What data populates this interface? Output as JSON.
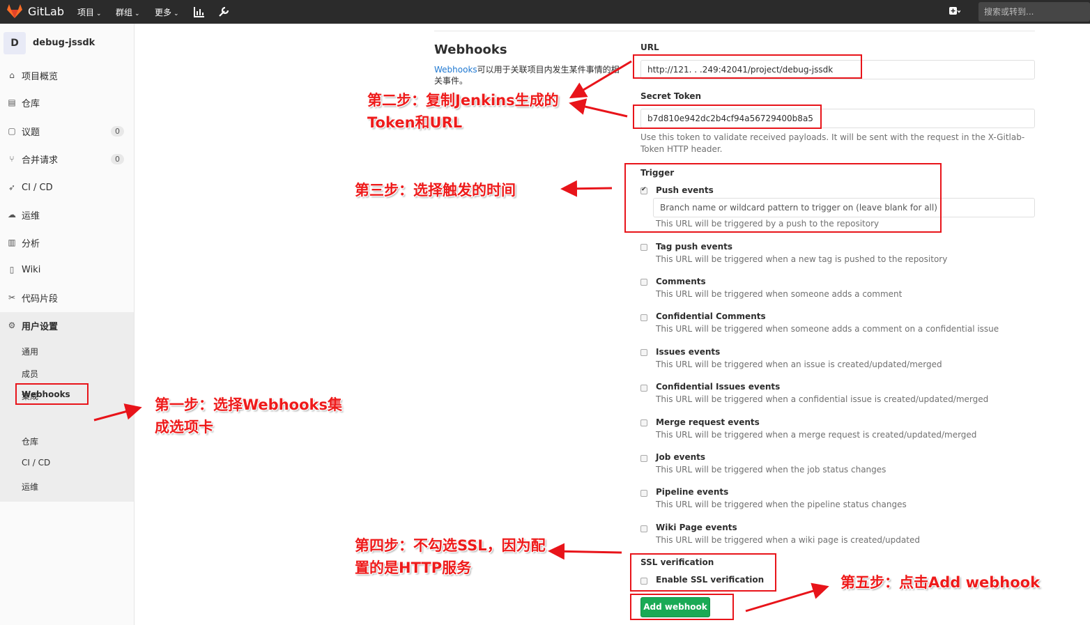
{
  "navbar": {
    "brand": "GitLab",
    "projects": "项目",
    "groups": "群组",
    "more": "更多",
    "search_placeholder": "搜索或转到..."
  },
  "sidebar": {
    "project_initial": "D",
    "project_name": "debug-jssdk",
    "items": [
      {
        "label": "项目概览",
        "icon": "home-icon"
      },
      {
        "label": "仓库",
        "icon": "doc-icon"
      },
      {
        "label": "议题",
        "icon": "issues-icon",
        "badge": "0"
      },
      {
        "label": "合并请求",
        "icon": "merge-icon",
        "badge": "0"
      },
      {
        "label": "CI / CD",
        "icon": "rocket-icon"
      },
      {
        "label": "运维",
        "icon": "cloud-icon"
      },
      {
        "label": "分析",
        "icon": "chart-icon"
      },
      {
        "label": "Wiki",
        "icon": "book-icon"
      },
      {
        "label": "代码片段",
        "icon": "scissors-icon"
      },
      {
        "label": "用户设置",
        "icon": "gear-icon"
      }
    ],
    "sub_items": [
      "通用",
      "成员",
      "集成",
      "Webhooks",
      "仓库",
      "CI / CD",
      "运维"
    ]
  },
  "main": {
    "title": "Webhooks",
    "desc_link": "Webhooks",
    "desc_rest": "可以用于关联项目内发生某件事情的相关事件。",
    "url_label": "URL",
    "url_value": "http://121.   .     .249:42041/project/debug-jssdk",
    "token_label": "Secret Token",
    "token_value": "b7d810e942dc2b4cf94a56729400b8a5",
    "token_help": "Use this token to validate received payloads. It will be sent with the request in the X-Gitlab-Token HTTP header.",
    "trigger_label": "Trigger",
    "push_events_label": "Push events",
    "branch_placeholder": "Branch name or wildcard pattern to trigger on (leave blank for all)",
    "push_help": "This URL will be triggered by a push to the repository",
    "events": [
      {
        "title": "Tag push events",
        "help": "This URL will be triggered when a new tag is pushed to the repository"
      },
      {
        "title": "Comments",
        "help": "This URL will be triggered when someone adds a comment"
      },
      {
        "title": "Confidential Comments",
        "help": "This URL will be triggered when someone adds a comment on a confidential issue"
      },
      {
        "title": "Issues events",
        "help": "This URL will be triggered when an issue is created/updated/merged"
      },
      {
        "title": "Confidential Issues events",
        "help": "This URL will be triggered when a confidential issue is created/updated/merged"
      },
      {
        "title": "Merge request events",
        "help": "This URL will be triggered when a merge request is created/updated/merged"
      },
      {
        "title": "Job events",
        "help": "This URL will be triggered when the job status changes"
      },
      {
        "title": "Pipeline events",
        "help": "This URL will be triggered when the pipeline status changes"
      },
      {
        "title": "Wiki Page events",
        "help": "This URL will be triggered when a wiki page is created/updated"
      }
    ],
    "ssl_label": "SSL verification",
    "ssl_checkbox_label": "Enable SSL verification",
    "add_button": "Add webhook"
  },
  "annotations": {
    "step1": "第一步：选择Webhooks集成选项卡",
    "step2": "第二步：复制Jenkins生成的Token和URL",
    "step3": "第三步：选择触发的时间",
    "step4": "第四步：不勾选SSL，因为配置的是HTTP服务",
    "step5": "第五步：点击Add webhook",
    "color": "#ee1b1b"
  }
}
